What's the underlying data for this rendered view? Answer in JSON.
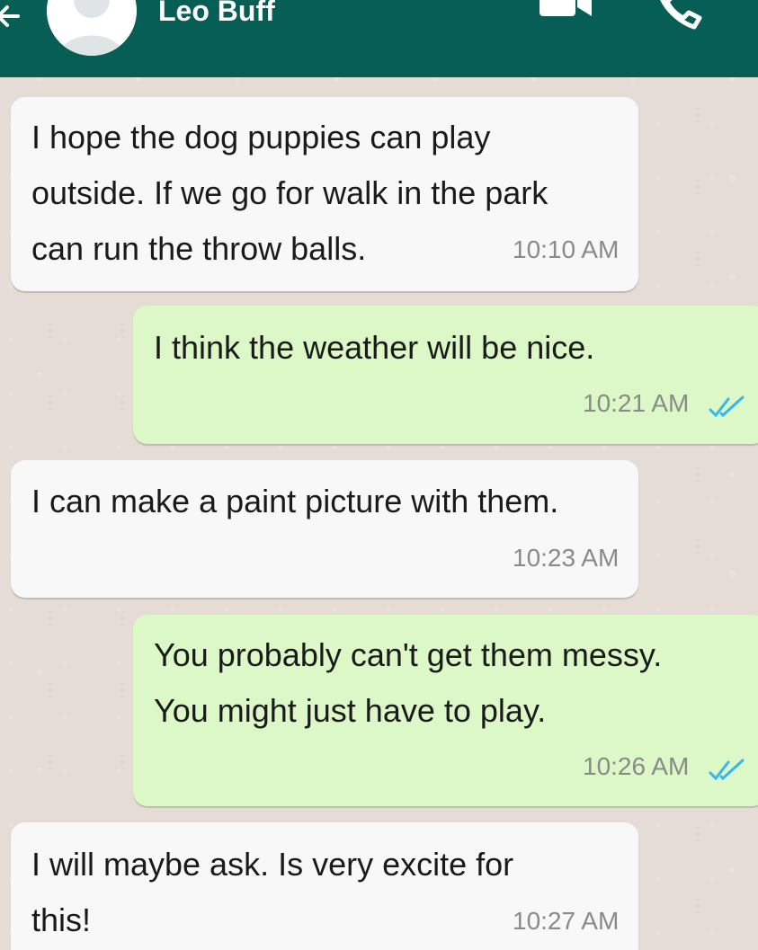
{
  "header": {
    "contact_name": "Leo Buff",
    "icons": [
      "back-arrow-icon",
      "avatar",
      "video-call-icon",
      "phone-call-icon"
    ],
    "bar_color": "#075e54"
  },
  "messages": [
    {
      "direction": "incoming",
      "lines": [
        "I hope the dog puppies can play",
        "outside. If we go for walk in the park",
        "can run the throw balls."
      ],
      "time": "10:10 AM"
    },
    {
      "direction": "outgoing",
      "lines": [
        "I think the weather will be nice."
      ],
      "time": "10:21 AM",
      "read": true
    },
    {
      "direction": "incoming",
      "lines": [
        "I can make a paint picture with them."
      ],
      "time": "10:23 AM"
    },
    {
      "direction": "outgoing",
      "lines": [
        "You probably can't get them messy.",
        "You might just have to play."
      ],
      "time": "10:26 AM",
      "read": true
    },
    {
      "direction": "incoming",
      "lines": [
        "I will maybe ask. Is very excite for",
        "this!"
      ],
      "time": "10:27 AM"
    }
  ],
  "colors": {
    "incoming_bubble": "#f8f8f8",
    "outgoing_bubble": "#dcf8c6",
    "read_tick": "#34b7f1",
    "chat_background": "#e5ddd5"
  }
}
